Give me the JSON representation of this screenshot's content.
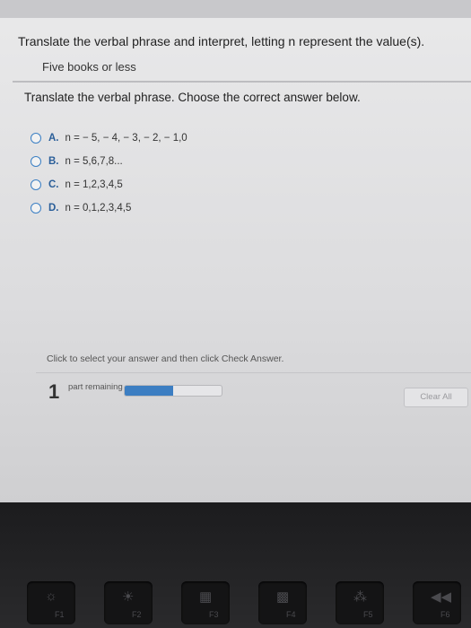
{
  "question": {
    "title": "Translate the verbal phrase and interpret, letting n represent the value(s).",
    "phrase": "Five books or less"
  },
  "prompt": {
    "instruction": "Translate the verbal phrase. Choose the correct answer below."
  },
  "options": [
    {
      "letter": "A.",
      "text": "n = − 5, − 4, − 3, − 2, − 1,0"
    },
    {
      "letter": "B.",
      "text": "n = 5,6,7,8..."
    },
    {
      "letter": "C.",
      "text": "n = 1,2,3,4,5"
    },
    {
      "letter": "D.",
      "text": "n = 0,1,2,3,4,5"
    }
  ],
  "footer": {
    "hint": "Click to select your answer and then click Check Answer.",
    "parts_count": "1",
    "parts_label": "part remaining",
    "progress_fraction": 0.5,
    "clear_all_label": "Clear All"
  },
  "keyboard": {
    "keys": [
      {
        "icon": "sun-low-icon",
        "glyph": "☼",
        "fn": "F1"
      },
      {
        "icon": "sun-high-icon",
        "glyph": "☀",
        "fn": "F2"
      },
      {
        "icon": "mission-control-icon",
        "glyph": "▦",
        "fn": "F3"
      },
      {
        "icon": "launchpad-icon",
        "glyph": "▩",
        "fn": "F4"
      },
      {
        "icon": "keyboard-light-icon",
        "glyph": "⁂",
        "fn": "F5"
      },
      {
        "icon": "rewind-icon",
        "glyph": "◀◀",
        "fn": "F6"
      }
    ]
  },
  "colors": {
    "accent": "#3c7ec2",
    "option_letter": "#2a5e99"
  }
}
